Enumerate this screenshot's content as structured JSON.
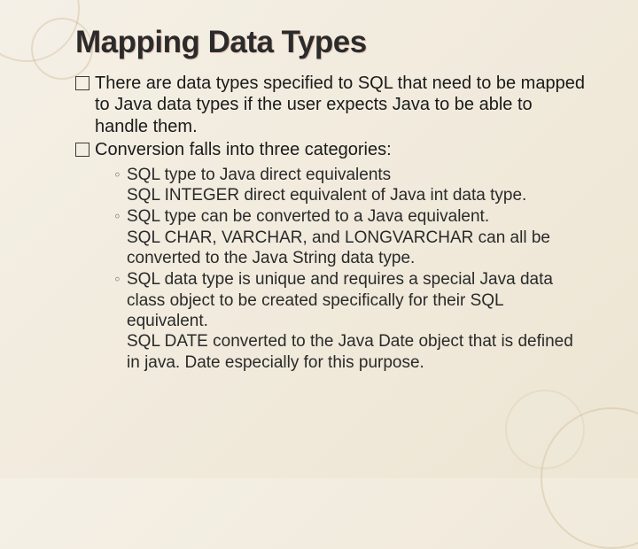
{
  "title": "Mapping Data Types",
  "bullets": [
    {
      "text": "There are data types specified to SQL that need to be mapped to Java data types if the user expects Java to be able to handle them."
    },
    {
      "text": "Conversion falls into three categories:",
      "sub": [
        {
          "head": "SQL type to Java direct equivalents",
          "desc": "SQL INTEGER direct equivalent of Java int data type."
        },
        {
          "head": "SQL type can be converted to a Java equivalent.",
          "desc": "SQL CHAR, VARCHAR, and LONGVARCHAR can all be converted to the Java String data type."
        },
        {
          "head": "SQL data type is unique and requires a special Java data class object to be created specifically for their SQL equivalent.",
          "desc": "SQL DATE converted to the Java Date object that is defined in java. Date especially for this purpose."
        }
      ]
    }
  ],
  "sub_marker": "◦"
}
